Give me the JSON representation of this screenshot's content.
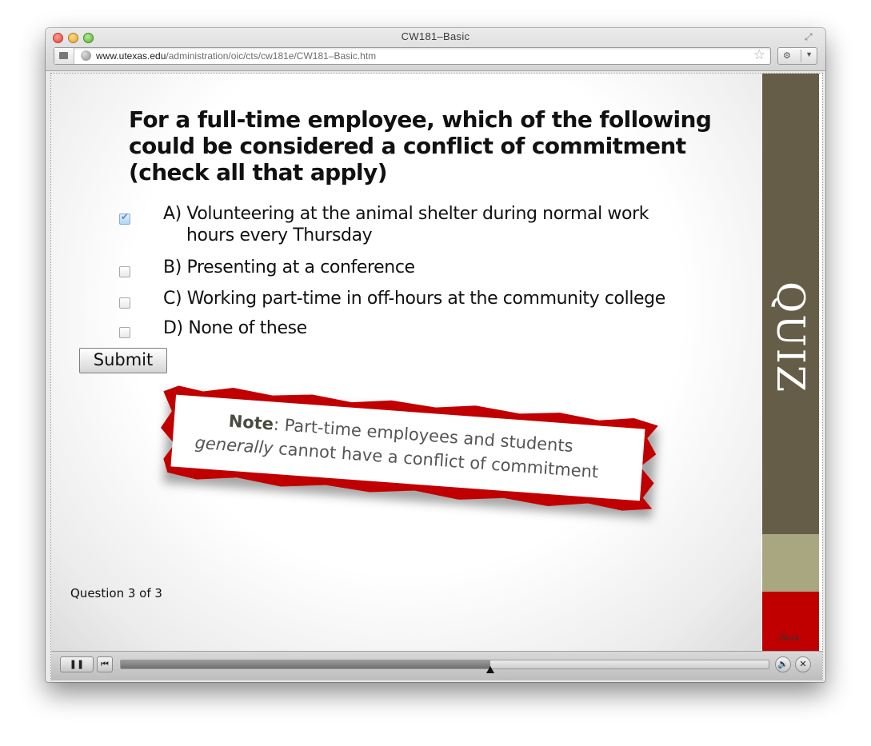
{
  "window": {
    "title": "CW181–Basic",
    "url": {
      "domain": "www.utexas.edu",
      "path": "/administration/oic/cts/cw181e/CW181–Basic.htm"
    }
  },
  "quiz": {
    "question": "For a full-time employee, which of the following could be considered a conflict of commitment (check all that apply)",
    "options": [
      {
        "line1": "A) Volunteering at the animal shelter during normal work",
        "line2": "hours every Thursday",
        "checked": true
      },
      {
        "line1": "B) Presenting at a conference",
        "checked": false
      },
      {
        "line1": "C) Working part-time in off-hours at the community college",
        "checked": false
      },
      {
        "line1": "D) None of these",
        "checked": false
      }
    ],
    "submit_label": "Submit",
    "note": {
      "bold": "Note",
      "rest1": ": Part-time employees and students",
      "italic": "generally",
      "rest2": " cannot have a conflict of commitment"
    },
    "counter": "Question 3 of 3",
    "side_label": "QUIZ"
  },
  "player": {
    "progress": 0.57,
    "pause_icon": "pause-icon",
    "rewind_icon": "rewind-icon",
    "volume_icon": "volume-icon",
    "close_icon": "close-icon"
  },
  "block_tag": "Block",
  "colors": {
    "rail_dark": "#665d48",
    "rail_tan": "#a9a780",
    "rail_red": "#c00000",
    "note_border": "#c00000"
  }
}
